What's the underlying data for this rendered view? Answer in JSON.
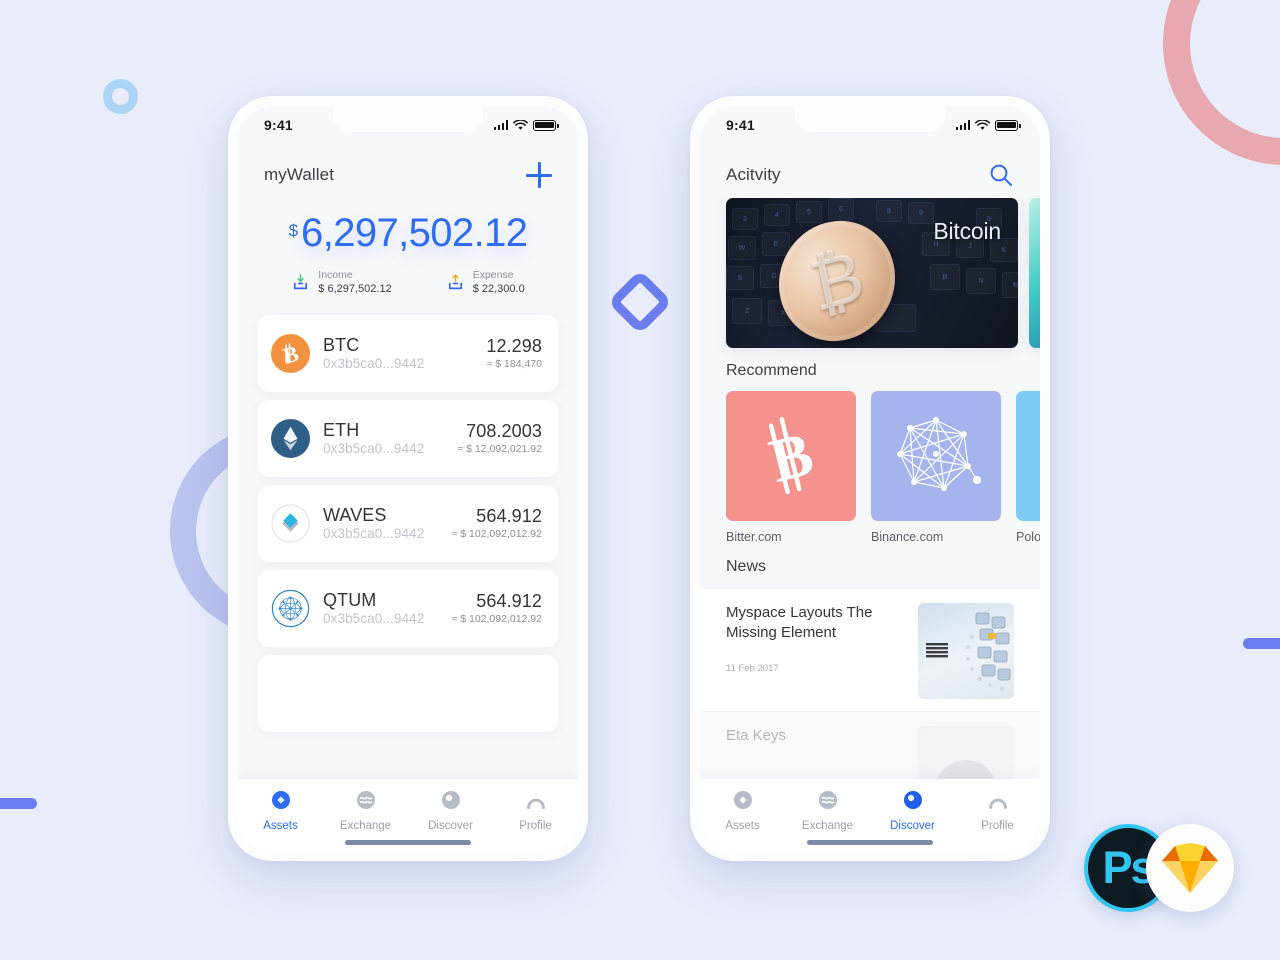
{
  "background": {
    "color": "#e8ecfb",
    "shapes": [
      "ring-small-blue",
      "ring-pink-large",
      "ring-periwinkle",
      "diamond-outline",
      "bar-left",
      "bar-right"
    ]
  },
  "logos": {
    "photoshop": "Ps",
    "sketch": "sketch-diamond-icon"
  },
  "phone1": {
    "status": {
      "time": "9:41",
      "signal": "signal-icon",
      "wifi": "wifi-icon",
      "battery": "battery-icon"
    },
    "appbar": {
      "title": "myWallet",
      "action": "add-icon"
    },
    "balance": {
      "currency": "$",
      "amount": "6,297,502.12"
    },
    "summary": [
      {
        "icon": "income-icon",
        "label": "Income",
        "value": "$ 6,297,502.12"
      },
      {
        "icon": "expense-icon",
        "label": "Expense",
        "value": "$ 22,300.0"
      }
    ],
    "coins": [
      {
        "icon": "btc-icon",
        "symbol": "BTC",
        "address": "0x3b5ca0...9442",
        "amount": "12.298",
        "fiat": "≈ $ 184,470"
      },
      {
        "icon": "eth-icon",
        "symbol": "ETH",
        "address": "0x3b5ca0...9442",
        "amount": "708.2003",
        "fiat": "≈ $ 12,092,021.92"
      },
      {
        "icon": "waves-icon",
        "symbol": "WAVES",
        "address": "0x3b5ca0...9442",
        "amount": "564.912",
        "fiat": "≈ $ 102,092,012.92"
      },
      {
        "icon": "qtum-icon",
        "symbol": "QTUM",
        "address": "0x3b5ca0...9442",
        "amount": "564.912",
        "fiat": "≈ $ 102,092,012.92"
      }
    ],
    "tabs": [
      {
        "icon": "assets-icon",
        "label": "Assets",
        "active": true
      },
      {
        "icon": "exchange-icon",
        "label": "Exchange",
        "active": false
      },
      {
        "icon": "discover-icon",
        "label": "Discover",
        "active": false
      },
      {
        "icon": "profile-icon",
        "label": "Profile",
        "active": false
      }
    ]
  },
  "phone2": {
    "status": {
      "time": "9:41",
      "signal": "signal-icon",
      "wifi": "wifi-icon",
      "battery": "battery-icon"
    },
    "appbar": {
      "title": "Acitvity",
      "action": "search-icon"
    },
    "banners": [
      {
        "caption": "Bitcoin",
        "image": "bitcoin-coin-on-keyboard"
      },
      {
        "caption": "",
        "image": "teal-abstract"
      }
    ],
    "recommend": {
      "title": "Recommend",
      "items": [
        {
          "name": "Bitter.com",
          "color": "#f4928d",
          "icon": "bitcoin-b-icon"
        },
        {
          "name": "Binance.com",
          "color": "#a6b4ee",
          "icon": "network-graph-icon"
        },
        {
          "name": "Polonie",
          "color": "#7ecbf5",
          "icon": "poloniex-icon"
        }
      ]
    },
    "news": {
      "title": "News",
      "items": [
        {
          "title": "Myspace Layouts The Missing Element",
          "date": "11 Feb 2017",
          "thumb": "ibm-server-photo"
        },
        {
          "title": "Eta Keys",
          "date": "",
          "thumb": "person-avatar-photo"
        }
      ]
    },
    "tabs": [
      {
        "icon": "assets-icon",
        "label": "Assets",
        "active": false
      },
      {
        "icon": "exchange-icon",
        "label": "Exchange",
        "active": false
      },
      {
        "icon": "discover-icon",
        "label": "Discover",
        "active": true
      },
      {
        "icon": "profile-icon",
        "label": "Profile",
        "active": false
      }
    ]
  }
}
